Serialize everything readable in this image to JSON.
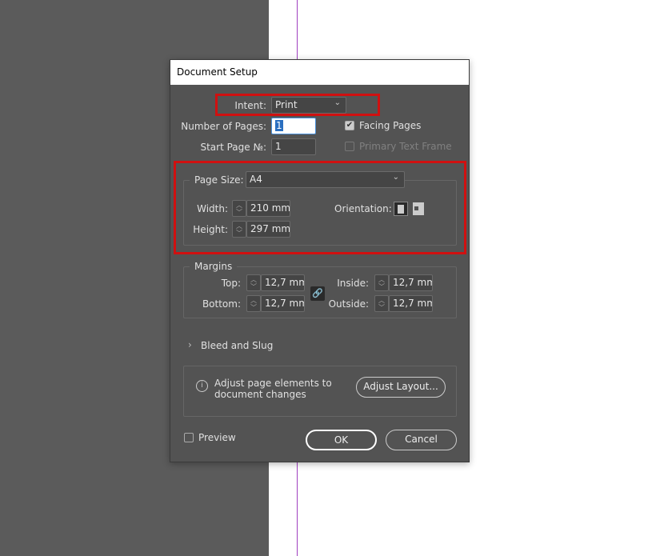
{
  "dialog": {
    "title": "Document Setup",
    "intent": {
      "label": "Intent:",
      "value": "Print"
    },
    "num_pages": {
      "label": "Number of Pages:",
      "value": "1"
    },
    "start_page": {
      "label": "Start Page №:",
      "value": "1"
    },
    "facing_pages": {
      "label": "Facing Pages",
      "checked": true
    },
    "primary_text_frame": {
      "label": "Primary Text Frame",
      "checked": false,
      "disabled": true
    },
    "page_size": {
      "label": "Page Size:",
      "value": "A4",
      "width": {
        "label": "Width:",
        "value": "210 mm"
      },
      "height": {
        "label": "Height:",
        "value": "297 mm"
      },
      "orientation": {
        "label": "Orientation:",
        "selected": "portrait"
      }
    },
    "margins": {
      "label": "Margins",
      "top": {
        "label": "Top:",
        "value": "12,7 mm"
      },
      "bottom": {
        "label": "Bottom:",
        "value": "12,7 mm"
      },
      "inside": {
        "label": "Inside:",
        "value": "12,7 mm"
      },
      "outside": {
        "label": "Outside:",
        "value": "12,7 mm"
      }
    },
    "bleed_slug": {
      "label": "Bleed and Slug"
    },
    "adjust": {
      "text1": "Adjust page elements to",
      "text2": "document changes",
      "button": "Adjust Layout..."
    },
    "preview": {
      "label": "Preview",
      "checked": false
    },
    "ok": "OK",
    "cancel": "Cancel"
  },
  "colors": {
    "highlight": "#d01010",
    "dialog_bg": "#535353",
    "guide": "#a040c0"
  }
}
